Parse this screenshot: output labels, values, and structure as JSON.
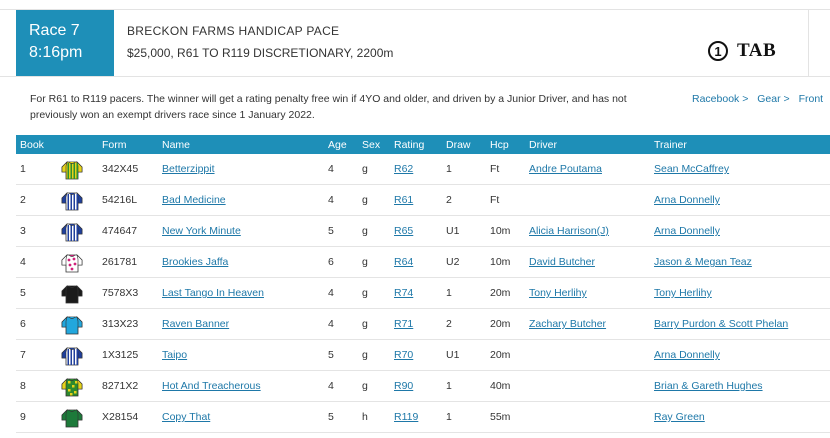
{
  "race": {
    "number_label": "Race 7",
    "time": "8:16pm",
    "name": "BRECKON FARMS HANDICAP PACE",
    "conditions": "$25,000, R61 TO R119 DISCRETIONARY, 2200m",
    "description": "For R61 to R119 pacers. The winner will get a rating penalty free win if 4YO and older, and driven by a Junior Driver, and has not previously won an exempt drivers race since 1 January 2022."
  },
  "brand": {
    "circle_glyph": "1",
    "name": "TAB"
  },
  "links": [
    {
      "label": "Racebook >"
    },
    {
      "label": "Gear >"
    },
    {
      "label": "Front"
    }
  ],
  "table": {
    "headers": {
      "book": "Book",
      "form": "Form",
      "name": "Name",
      "age": "Age",
      "sex": "Sex",
      "rating": "Rating",
      "draw": "Draw",
      "hcp": "Hcp",
      "driver": "Driver",
      "trainer": "Trainer"
    },
    "rows": [
      {
        "book": "1",
        "form": "342X45",
        "name": "Betterzippit",
        "age": "4",
        "sex": "g",
        "rating": "R62",
        "draw": "1",
        "hcp": "Ft",
        "driver": "Andre Poutama",
        "trainer": "Sean McCaffrey",
        "silk": "yellow-green-stripes"
      },
      {
        "book": "2",
        "form": "54216L",
        "name": "Bad Medicine",
        "age": "4",
        "sex": "g",
        "rating": "R61",
        "draw": "2",
        "hcp": "Ft",
        "driver": "",
        "trainer": "Arna Donnelly",
        "silk": "blue-white-stripes"
      },
      {
        "book": "3",
        "form": "474647",
        "name": "New York Minute",
        "age": "5",
        "sex": "g",
        "rating": "R65",
        "draw": "U1",
        "hcp": "10m",
        "driver": "Alicia Harrison(J)",
        "trainer": "Arna Donnelly",
        "silk": "blue-white-stripes"
      },
      {
        "book": "4",
        "form": "261781",
        "name": "Brookies Jaffa",
        "age": "6",
        "sex": "g",
        "rating": "R64",
        "draw": "U2",
        "hcp": "10m",
        "driver": "David Butcher",
        "trainer": "Jason & Megan Teaz",
        "silk": "white-pink-dots"
      },
      {
        "book": "5",
        "form": "7578X3",
        "name": "Last Tango In Heaven",
        "age": "4",
        "sex": "g",
        "rating": "R74",
        "draw": "1",
        "hcp": "20m",
        "driver": "Tony Herlihy",
        "trainer": "Tony Herlihy",
        "silk": "black"
      },
      {
        "book": "6",
        "form": "313X23",
        "name": "Raven Banner",
        "age": "4",
        "sex": "g",
        "rating": "R71",
        "draw": "2",
        "hcp": "20m",
        "driver": "Zachary Butcher",
        "trainer": "Barry Purdon & Scott Phelan",
        "silk": "light-blue"
      },
      {
        "book": "7",
        "form": "1X3125",
        "name": "Taipo",
        "age": "5",
        "sex": "g",
        "rating": "R70",
        "draw": "U1",
        "hcp": "20m",
        "driver": "",
        "trainer": "Arna Donnelly",
        "silk": "blue-white-stripes"
      },
      {
        "book": "8",
        "form": "8271X2",
        "name": "Hot And Treacherous",
        "age": "4",
        "sex": "g",
        "rating": "R90",
        "draw": "1",
        "hcp": "40m",
        "driver": "",
        "trainer": "Brian & Gareth Hughes",
        "silk": "green-yellow-check"
      },
      {
        "book": "9",
        "form": "X28154",
        "name": "Copy That",
        "age": "5",
        "sex": "h",
        "rating": "R119",
        "draw": "1",
        "hcp": "55m",
        "driver": "",
        "trainer": "Ray Green",
        "silk": "green"
      }
    ]
  },
  "colors": {
    "accent": "#1e8fb8",
    "link": "#1e78a8"
  }
}
